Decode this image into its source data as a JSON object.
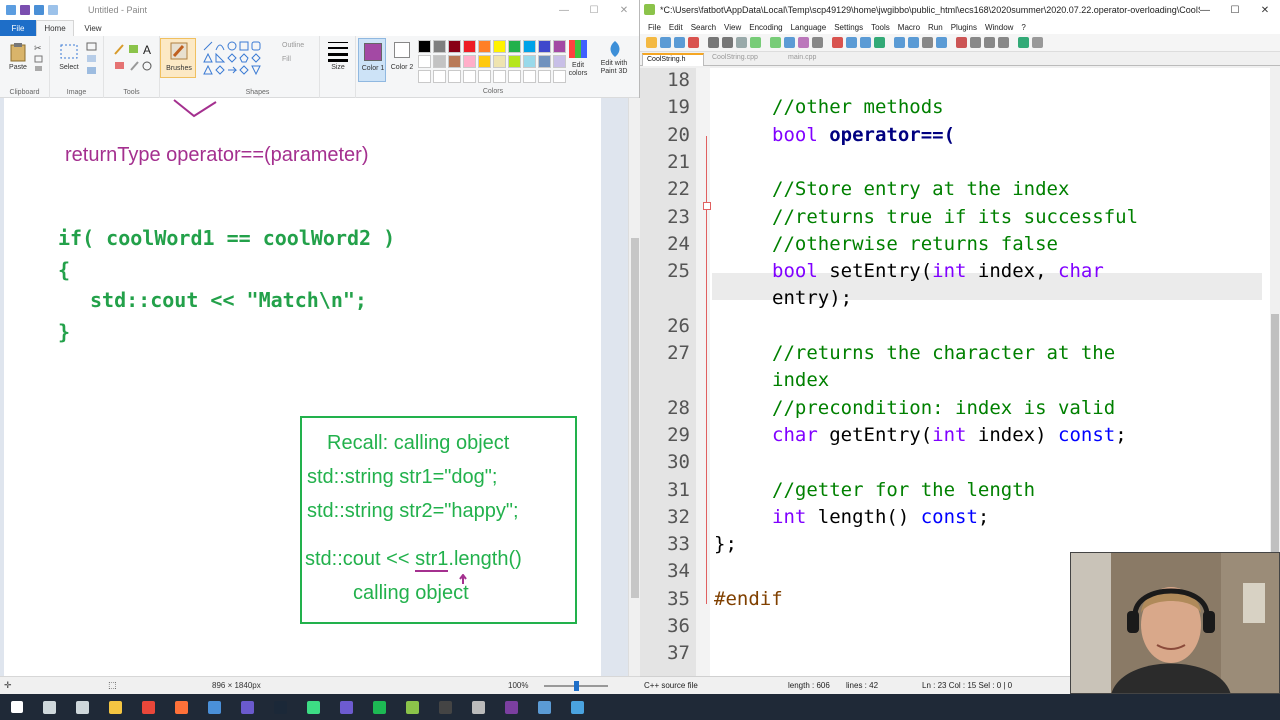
{
  "paint": {
    "title": "Untitled - Paint",
    "tabs": {
      "file": "File",
      "home": "Home",
      "view": "View"
    },
    "ribbon": {
      "paste": "Paste",
      "select": "Select",
      "brushes": "Brushes",
      "outline": "Outline",
      "fill": "Fill",
      "size": "Size",
      "color1": "Color 1",
      "color2": "Color 2",
      "edit_colors": "Edit colors",
      "edit_with_paint3d": "Edit with Paint 3D",
      "groups": {
        "clipboard": "Clipboard",
        "image": "Image",
        "tools": "Tools",
        "shapes": "Shapes",
        "colors": "Colors"
      }
    },
    "canvas": {
      "line1": "returnType operator==(parameter)",
      "line2": "if( coolWord1 == coolWord2 )",
      "line3": "{",
      "line4": "std::cout << \"Match\\n\";",
      "line5": "}",
      "recall": {
        "title": "Recall: calling object",
        "s1": "std::string str1=\"dog\";",
        "s2": "std::string str2=\"happy\";",
        "s3_prefix": "std::cout << ",
        "s3_obj": "str1",
        "s3_suffix": ".length()",
        "caption": "calling object"
      }
    },
    "status": {
      "dimensions": "896 × 1840px",
      "zoom": "100%"
    }
  },
  "npp": {
    "title": "*C:\\Users\\fatbot\\AppData\\Local\\Temp\\scp49129\\home\\jwgibbo\\public_html\\ecs168\\2020summer\\2020.07.22.operator-overloading\\CoolString.h - Notepad++",
    "menu": [
      "File",
      "Edit",
      "Search",
      "View",
      "Encoding",
      "Language",
      "Settings",
      "Tools",
      "Macro",
      "Run",
      "Plugins",
      "Window",
      "?"
    ],
    "tabs": [
      "CoolString.h",
      "CoolString.cpp",
      "main.cpp"
    ],
    "lines": [
      {
        "n": "18",
        "parts": []
      },
      {
        "n": "19",
        "parts": [
          {
            "c": "c-cmt",
            "t": "//other methods"
          }
        ]
      },
      {
        "n": "20",
        "parts": [
          {
            "c": "c-type",
            "t": "bool"
          },
          {
            "c": "c-def",
            "t": " "
          },
          {
            "c": "c-op",
            "t": "operator==("
          }
        ]
      },
      {
        "n": "21",
        "parts": []
      },
      {
        "n": "22",
        "parts": [
          {
            "c": "c-cmt",
            "t": "//Store entry at the index"
          }
        ]
      },
      {
        "n": "23",
        "parts": [
          {
            "c": "c-cmt",
            "t": "//returns true if its successful"
          }
        ]
      },
      {
        "n": "24",
        "parts": [
          {
            "c": "c-cmt",
            "t": "//otherwise returns false"
          }
        ]
      },
      {
        "n": "25",
        "parts": [
          {
            "c": "c-type",
            "t": "bool"
          },
          {
            "c": "c-def",
            "t": " setEntry("
          },
          {
            "c": "c-type",
            "t": "int"
          },
          {
            "c": "c-def",
            "t": " index, "
          },
          {
            "c": "c-type",
            "t": "char"
          }
        ]
      },
      {
        "n": "",
        "parts": [
          {
            "c": "c-def",
            "t": "entry);"
          }
        ]
      },
      {
        "n": "26",
        "parts": []
      },
      {
        "n": "27",
        "parts": [
          {
            "c": "c-cmt",
            "t": "//returns the character at the"
          }
        ]
      },
      {
        "n": "",
        "parts": [
          {
            "c": "c-cmt",
            "t": "index"
          }
        ]
      },
      {
        "n": "28",
        "parts": [
          {
            "c": "c-cmt",
            "t": "//precondition: index is valid"
          }
        ]
      },
      {
        "n": "29",
        "parts": [
          {
            "c": "c-type",
            "t": "char"
          },
          {
            "c": "c-def",
            "t": " getEntry("
          },
          {
            "c": "c-type",
            "t": "int"
          },
          {
            "c": "c-def",
            "t": " index) "
          },
          {
            "c": "c-kw",
            "t": "const"
          },
          {
            "c": "c-def",
            "t": ";"
          }
        ]
      },
      {
        "n": "30",
        "parts": []
      },
      {
        "n": "31",
        "parts": [
          {
            "c": "c-cmt",
            "t": "//getter for the length"
          }
        ]
      },
      {
        "n": "32",
        "parts": [
          {
            "c": "c-type",
            "t": "int"
          },
          {
            "c": "c-def",
            "t": " length() "
          },
          {
            "c": "c-kw",
            "t": "const"
          },
          {
            "c": "c-def",
            "t": ";"
          }
        ]
      },
      {
        "n": "33",
        "parts": [
          {
            "c": "c-def",
            "t": "};"
          }
        ],
        "top": true
      },
      {
        "n": "34",
        "parts": []
      },
      {
        "n": "35",
        "parts": [
          {
            "c": "c-pre",
            "t": "#endif"
          }
        ],
        "top": true
      },
      {
        "n": "36",
        "parts": []
      },
      {
        "n": "37",
        "parts": []
      }
    ],
    "status": {
      "file_type": "C++ source file",
      "length": "length : 606",
      "lines": "lines : 42",
      "position": "Ln : 23   Col : 15   Sel : 0 | 0"
    }
  },
  "colors": {
    "paint_purple": "#a4308f",
    "paint_green": "#22b14c",
    "file_tab": "#1e6ec8",
    "taskbar": "#1f2937",
    "palette": [
      "#000000",
      "#7f7f7f",
      "#880015",
      "#ed1c24",
      "#ff7f27",
      "#fff200",
      "#22b14c",
      "#00a2e8",
      "#3f48cc",
      "#a349a4",
      "#ffffff",
      "#c3c3c3",
      "#b97a57",
      "#ffaec9",
      "#ffc90e",
      "#efe4b0",
      "#b5e61d",
      "#99d9ea",
      "#7092be",
      "#c8bfe7",
      "#ffffff",
      "#ffffff",
      "#ffffff",
      "#ffffff",
      "#ffffff",
      "#ffffff",
      "#ffffff",
      "#ffffff",
      "#ffffff",
      "#ffffff"
    ]
  },
  "taskbar_icons": [
    "windows-start-icon",
    "search-icon",
    "task-view-icon",
    "file-explorer-icon",
    "chrome-icon",
    "firefox-icon",
    "mail-icon",
    "visual-studio-icon",
    "steam-icon",
    "pycharm-icon",
    "obs-icon",
    "spotify-icon",
    "notepadpp-icon",
    "terminal-icon",
    "settings-icon",
    "onenote-icon",
    "paint-icon",
    "snip-icon"
  ]
}
